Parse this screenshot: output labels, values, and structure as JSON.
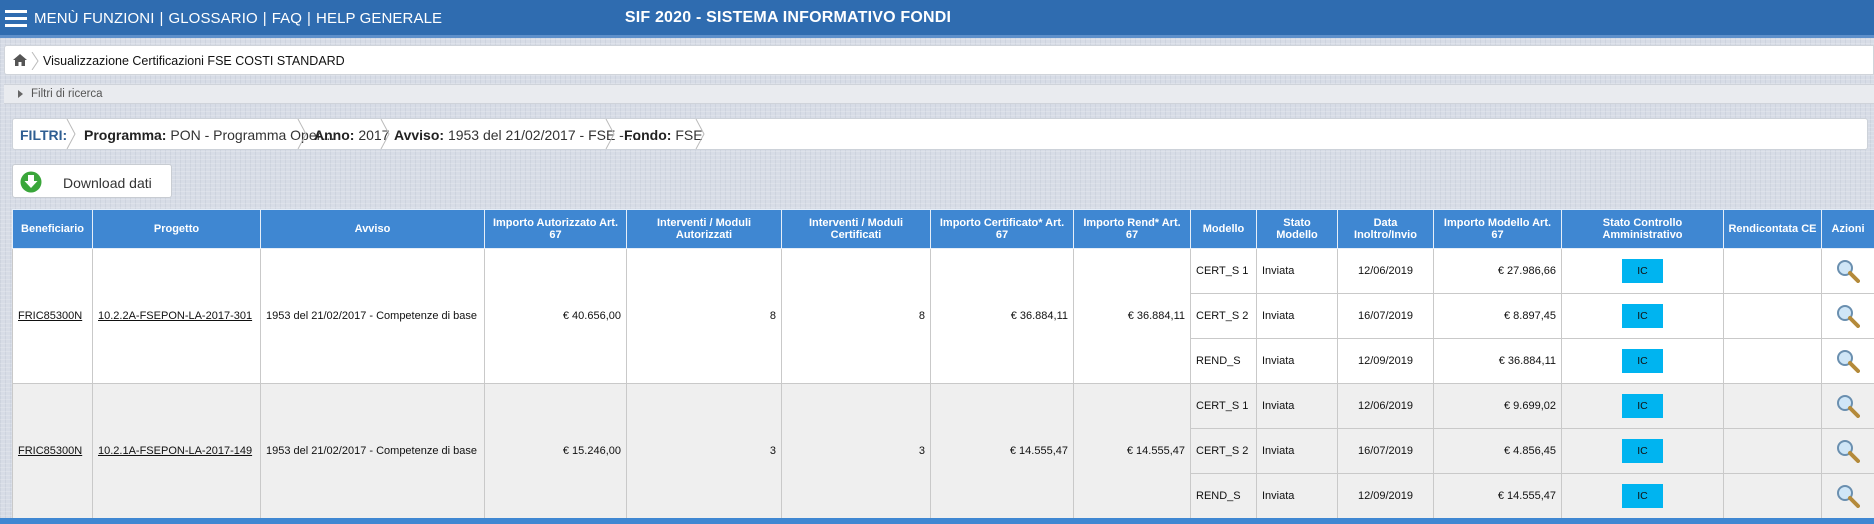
{
  "topbar": {
    "menu_links": [
      "MENÙ FUNZIONI",
      "GLOSSARIO",
      "FAQ",
      "HELP GENERALE"
    ],
    "separator": "|",
    "title": "SIF 2020 - SISTEMA INFORMATIVO FONDI",
    "color": "#2f6cb0"
  },
  "breadcrumb": {
    "current": "Visualizzazione Certificazioni FSE COSTI STANDARD"
  },
  "filters_panel": {
    "label": "Filtri di ricerca"
  },
  "filter_bar": {
    "title": "FILTRI:",
    "items": [
      {
        "key": "Programma:",
        "value": "PON - Programma Oper…"
      },
      {
        "key": "Anno:",
        "value": "2017"
      },
      {
        "key": "Avviso:",
        "value": "1953 del 21/02/2017 - FSE - …"
      },
      {
        "key": "Fondo:",
        "value": "FSE"
      }
    ]
  },
  "download": {
    "label": "Download dati",
    "icon": "download-arrow-icon"
  },
  "table": {
    "header_color": "#3f87d2",
    "columns": [
      "Beneficiario",
      "Progetto",
      "Avviso",
      "Importo Autorizzato Art. 67",
      "Interventi / Moduli Autorizzati",
      "Interventi / Moduli Certificati",
      "Importo Certificato* Art. 67",
      "Importo Rend* Art. 67",
      "Modello",
      "Stato Modello",
      "Data Inoltro/Invio",
      "Importo Modello Art. 67",
      "Stato Controllo Amministrativo",
      "Rendicontata CE",
      "Azioni"
    ],
    "groups": [
      {
        "beneficiario": "FRIC85300N",
        "progetto": "10.2.2A-FSEPON-LA-2017-301",
        "avviso": "1953 del 21/02/2017 - Competenze di base",
        "importo_autorizzato": "€ 40.656,00",
        "moduli_autorizzati": "8",
        "moduli_certificati": "8",
        "importo_certificato": "€ 36.884,11",
        "importo_rend": "€ 36.884,11",
        "rows": [
          {
            "modello": "CERT_S 1",
            "stato": "Inviata",
            "data": "12/06/2019",
            "importo": "€ 27.986,66",
            "controllo": "IC",
            "rendicontata": ""
          },
          {
            "modello": "CERT_S 2",
            "stato": "Inviata",
            "data": "16/07/2019",
            "importo": "€ 8.897,45",
            "controllo": "IC",
            "rendicontata": ""
          },
          {
            "modello": "REND_S",
            "stato": "Inviata",
            "data": "12/09/2019",
            "importo": "€ 36.884,11",
            "controllo": "IC",
            "rendicontata": ""
          }
        ]
      },
      {
        "beneficiario": "FRIC85300N",
        "progetto": "10.2.1A-FSEPON-LA-2017-149",
        "avviso": "1953 del 21/02/2017 - Competenze di base",
        "importo_autorizzato": "€ 15.246,00",
        "moduli_autorizzati": "3",
        "moduli_certificati": "3",
        "importo_certificato": "€ 14.555,47",
        "importo_rend": "€ 14.555,47",
        "rows": [
          {
            "modello": "CERT_S 1",
            "stato": "Inviata",
            "data": "12/06/2019",
            "importo": "€ 9.699,02",
            "controllo": "IC",
            "rendicontata": ""
          },
          {
            "modello": "CERT_S 2",
            "stato": "Inviata",
            "data": "16/07/2019",
            "importo": "€ 4.856,45",
            "controllo": "IC",
            "rendicontata": ""
          },
          {
            "modello": "REND_S",
            "stato": "Inviata",
            "data": "12/09/2019",
            "importo": "€ 14.555,47",
            "controllo": "IC",
            "rendicontata": ""
          }
        ]
      }
    ],
    "action_icon": "magnifier-icon",
    "badge_color": "#00b4f0"
  }
}
